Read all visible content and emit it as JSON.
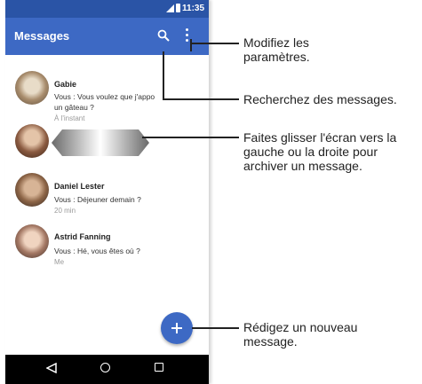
{
  "status_bar": {
    "time": "11:35"
  },
  "app_bar": {
    "title": "Messages"
  },
  "conversations": [
    {
      "name": "Gabie",
      "preview_line1": "Vous : Vous voulez que j'appo",
      "preview_line2": "un gâteau ?",
      "time": "À l'instant"
    },
    {
      "name": "Daniel Lester",
      "preview_line1": "Vous : Déjeuner demain ?",
      "time": "20 min"
    },
    {
      "name": "Astrid Fanning",
      "preview_line1": "Vous : Hé, vous êtes où ?",
      "time": "Me"
    }
  ],
  "callouts": [
    "Modifiez les paramètres.",
    "Recherchez des messages.",
    "Faites glisser l'écran vers la gauche ou la droite pour archiver un message.",
    "Rédigez un nouveau message."
  ],
  "icons": [
    "signal-icon",
    "battery-icon",
    "search-icon",
    "more-vert-icon",
    "add-icon",
    "back-icon",
    "home-icon",
    "recents-icon"
  ],
  "colors": {
    "status_bar": "#2a54a6",
    "app_bar": "#3d69c4",
    "fab": "#3d69c4",
    "nav_bar": "#000000"
  }
}
